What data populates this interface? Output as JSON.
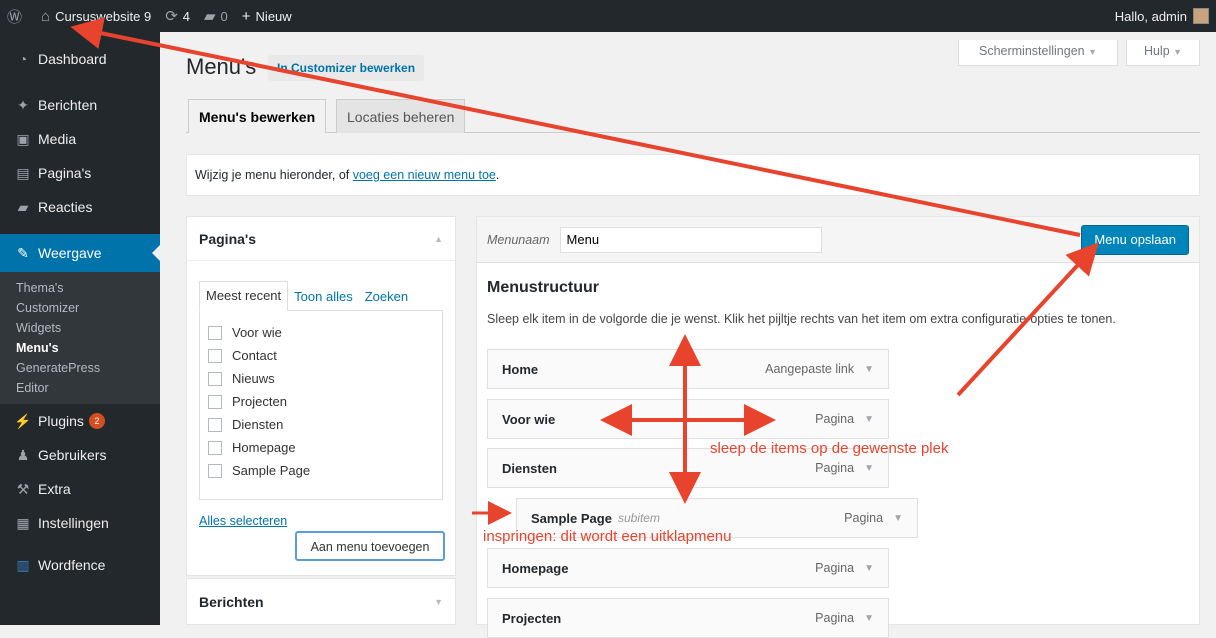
{
  "adminbar": {
    "site": "Cursuswebsite 9",
    "updates": "4",
    "comments": "0",
    "new": "Nieuw",
    "greeting": "Hallo, admin"
  },
  "sidebar": {
    "items": [
      {
        "label": "Dashboard",
        "icon": "dashboard-icon"
      },
      {
        "label": "Berichten",
        "icon": "pin-icon"
      },
      {
        "label": "Media",
        "icon": "media-icon"
      },
      {
        "label": "Pagina's",
        "icon": "page-icon"
      },
      {
        "label": "Reacties",
        "icon": "comment-icon"
      },
      {
        "label": "Weergave",
        "icon": "brush-icon"
      },
      {
        "label": "Plugins",
        "icon": "plugin-icon",
        "badge": "2"
      },
      {
        "label": "Gebruikers",
        "icon": "users-icon"
      },
      {
        "label": "Extra",
        "icon": "wrench-icon"
      },
      {
        "label": "Instellingen",
        "icon": "settings-icon"
      },
      {
        "label": "Wordfence",
        "icon": "wordfence-icon"
      }
    ],
    "submenu": [
      "Thema's",
      "Customizer",
      "Widgets",
      "Menu's",
      "GeneratePress",
      "Editor"
    ],
    "submenu_current": "Menu's"
  },
  "header": {
    "title": "Menu's",
    "customizer_btn": "In Customizer bewerken",
    "screen_options": "Scherminstellingen",
    "help": "Hulp"
  },
  "tabs": [
    "Menu's bewerken",
    "Locaties beheren"
  ],
  "notice": {
    "text": "Wijzig je menu hieronder, of ",
    "link": "voeg een nieuw menu toe",
    "end": "."
  },
  "pages_box": {
    "title": "Pagina's",
    "tabs": [
      "Meest recent",
      "Toon alles",
      "Zoeken"
    ],
    "pages": [
      "Voor wie",
      "Contact",
      "Nieuws",
      "Projecten",
      "Diensten",
      "Homepage",
      "Sample Page"
    ],
    "select_all": "Alles selecteren",
    "add_btn": "Aan menu toevoegen"
  },
  "posts_box": {
    "title": "Berichten"
  },
  "menu": {
    "name_label": "Menunaam",
    "name_value": "Menu",
    "save_btn": "Menu opslaan",
    "structure_title": "Menustructuur",
    "structure_desc": "Sleep elk item in de volgorde die je wenst. Klik het pijltje rechts van het item om extra configuratie-opties te tonen.",
    "items": [
      {
        "title": "Home",
        "type": "Aangepaste link"
      },
      {
        "title": "Voor wie",
        "type": "Pagina"
      },
      {
        "title": "Diensten",
        "type": "Pagina"
      },
      {
        "title": "Sample Page",
        "sub": "subitem",
        "type": "Pagina"
      },
      {
        "title": "Homepage",
        "type": "Pagina"
      },
      {
        "title": "Projecten",
        "type": "Pagina"
      }
    ]
  },
  "annotations": {
    "drag": "sleep de items op de gewenste plek",
    "indent": "inspringen: dit wordt een uitklapmenu"
  },
  "colors": {
    "accent": "#0073aa",
    "annotation": "#e8432d",
    "adminbar": "#23282d"
  }
}
